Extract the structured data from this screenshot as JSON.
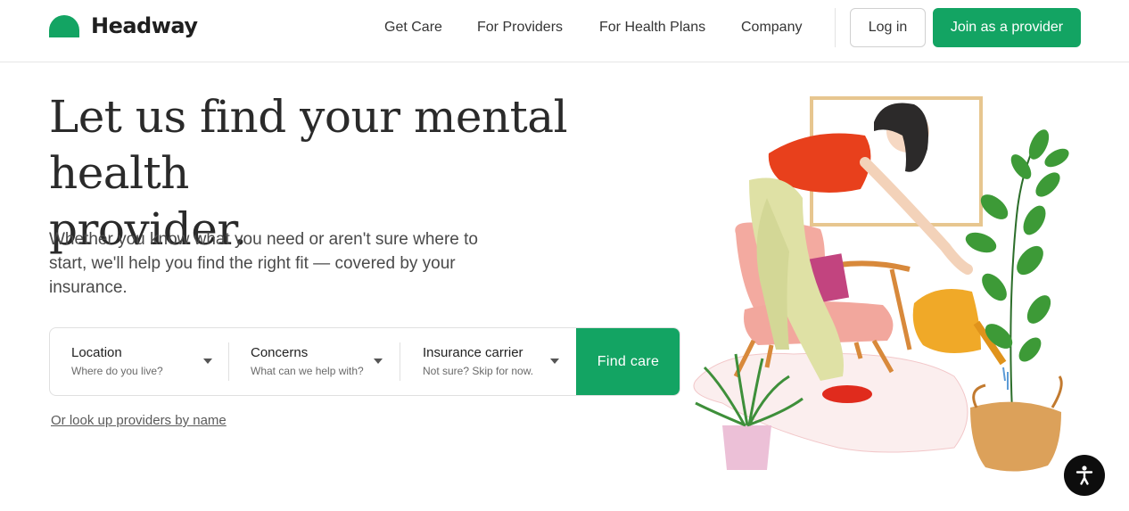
{
  "brand": {
    "name": "Headway",
    "accent": "#13a463"
  },
  "nav": {
    "items": [
      {
        "label": "Get Care"
      },
      {
        "label": "For Providers"
      },
      {
        "label": "For Health Plans"
      },
      {
        "label": "Company"
      }
    ],
    "login_label": "Log in",
    "join_label": "Join as a provider"
  },
  "hero": {
    "title_line1": "Let us find your mental health",
    "title_line2": "provider.",
    "subtitle": "Whether you know what you need or aren't sure where to start, we'll help you find the right fit — covered by your insurance."
  },
  "search": {
    "fields": [
      {
        "label": "Location",
        "hint": "Where do you live?"
      },
      {
        "label": "Concerns",
        "hint": "What can we help with?"
      },
      {
        "label": "Insurance carrier",
        "hint": "Not sure? Skip for now."
      }
    ],
    "submit_label": "Find care"
  },
  "lookup_link": "Or look up providers by name",
  "icons": {
    "logo": "headway-half-circle-logo",
    "caret": "chevron-down-icon",
    "accessibility": "accessibility-icon"
  }
}
